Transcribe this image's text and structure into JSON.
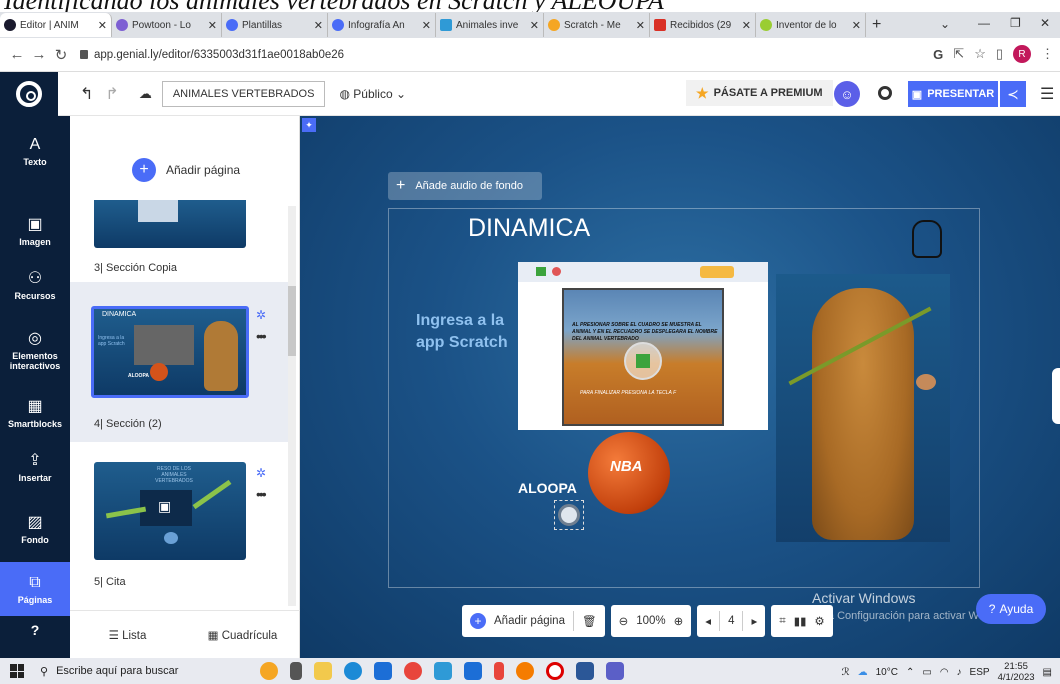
{
  "caption": "Identificando los animales vertebrados en Scratch y ALEOUPA",
  "browser": {
    "tabs": [
      {
        "label": "Editor | ANIM",
        "color": "#1a1a2e",
        "active": true
      },
      {
        "label": "Powtoon - Lo",
        "color": "#7d5fd3"
      },
      {
        "label": "Plantillas",
        "color": "#4a6cf7"
      },
      {
        "label": "Infografía An",
        "color": "#4a6cf7"
      },
      {
        "label": "Animales inve",
        "color": "#2f9ad6"
      },
      {
        "label": "Scratch - Me",
        "color": "#f5a623"
      },
      {
        "label": "Recibidos (29",
        "color": "#d93025"
      },
      {
        "label": "Inventor de lo",
        "color": "#9acd32"
      }
    ],
    "url": "app.genial.ly/editor/6335003d31f1ae0018ab0e26",
    "profile_initial": "R"
  },
  "header": {
    "title": "ANIMALES VERTEBRADOS",
    "visibility": "Público",
    "premium_label": "PÁSATE A PREMIUM",
    "present_label": "PRESENTAR"
  },
  "sidebar": {
    "items": [
      {
        "label": "Texto",
        "icon": "A"
      },
      {
        "label": "Imagen",
        "icon": "▣"
      },
      {
        "label": "Recursos",
        "icon": "⚇"
      },
      {
        "label": "Elementos interactivos",
        "icon": "◎"
      },
      {
        "label": "Smartblocks",
        "icon": "▦"
      },
      {
        "label": "Insertar",
        "icon": "⇪"
      },
      {
        "label": "Fondo",
        "icon": "▨"
      },
      {
        "label": "Páginas",
        "icon": "⧉"
      }
    ]
  },
  "pages_panel": {
    "add_page": "Añadir página",
    "pages": [
      {
        "label": "3| Sección Copia"
      },
      {
        "label": "4| Sección (2)"
      },
      {
        "label": "5| Cita"
      }
    ],
    "thumb4_title": "DINAMICA",
    "thumb4_text": "Ingresa a la app Scratch",
    "thumb4_aloopa": "ALOOPA",
    "thumb5_title": "RESO DE LOS ANIMALES VERTEBRADOS",
    "view_list": "Lista",
    "view_grid": "Cuadrícula"
  },
  "canvas": {
    "audio_label": "Añade audio de fondo",
    "slide_title": "DINAMICA",
    "ingresa": "Ingresa a la app Scratch",
    "scratch_line1": "AL PRESIONAR SOBRE EL CUADRO SE MUESTRA EL ANIMAL Y EN EL RECUADRO SE DESPLEGARA EL NOMBRE DEL ANIMAL VERTEBRADO",
    "scratch_line2": "PARA FINALIZAR PRESIONA LA TECLA F",
    "ball_text": "NBA",
    "aloopa": "ALOOPA",
    "activar_title": "Activar Windows",
    "activar_sub": "Ve a Configuración para activar Windows.",
    "help": "Ayuda"
  },
  "bottom_toolbar": {
    "add_page": "Añadir página",
    "zoom": "100%",
    "page_number": "4"
  },
  "taskbar": {
    "search_placeholder": "Escribe aquí para buscar",
    "weather": "10°C",
    "lang": "ESP",
    "time": "21:55",
    "date": "4/1/2023"
  }
}
